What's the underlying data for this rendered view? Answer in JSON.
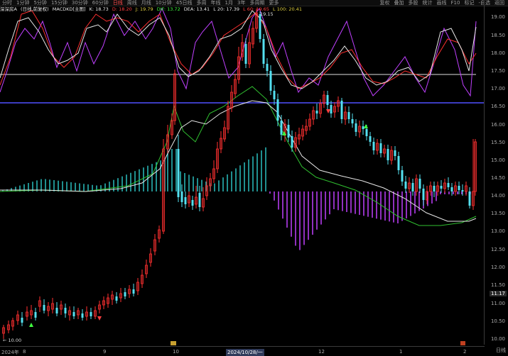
{
  "toolbar": {
    "items": [
      "分时",
      "1分钟",
      "5分钟",
      "15分钟",
      "30分钟",
      "60分钟",
      "日线",
      "周线",
      "月线",
      "10分钟",
      "45日线",
      "多周",
      "年线",
      "1月",
      "3年",
      "多周期",
      "更多"
    ],
    "active_index": 6,
    "right_items": [
      "复权",
      "叠加",
      "多股",
      "统计",
      "画线",
      "F10",
      "标记",
      "-自选",
      "返回"
    ]
  },
  "info": {
    "name": "深深房A",
    "period": "(日线,前复权)",
    "indicator": "MACDKD[主图]",
    "k": "K: 18.73",
    "d": "D: 18.20",
    "j": "J: 19.79",
    "dif": "DIF: 13.72",
    "dea": "DEA: 13.41",
    "l20": "L 20: 17.39",
    "l60": "L 60: 19.65",
    "l100": "L 100: 20.41"
  },
  "y_axis": {
    "labels": [
      "19.00",
      "18.50",
      "18.00",
      "17.50",
      "17.00",
      "16.50",
      "16.00",
      "15.50",
      "15.00",
      "14.50",
      "14.00",
      "13.50",
      "13.00",
      "12.50",
      "12.00",
      "11.50",
      "11.00",
      "10.50",
      "10.00"
    ],
    "current_price": "11.17"
  },
  "x_axis": {
    "labels": [
      "2024年",
      "8",
      "9",
      "10",
      "2024/10/28/一",
      "12",
      "1",
      "2"
    ],
    "day_button": "日线"
  },
  "annotations": {
    "max_label": "19.15",
    "min_label": "← 10.00"
  },
  "colors": {
    "up": "#ff3030",
    "down": "#54e0f0",
    "ma_white": "#e8e8e8",
    "ma_red": "#ff3030",
    "kdj_magenta": "#c040ff",
    "macd_green": "#30c030",
    "hist_pos": "#2abfbf",
    "hist_neg": "#c040ff",
    "hline": "#5050ff"
  }
}
